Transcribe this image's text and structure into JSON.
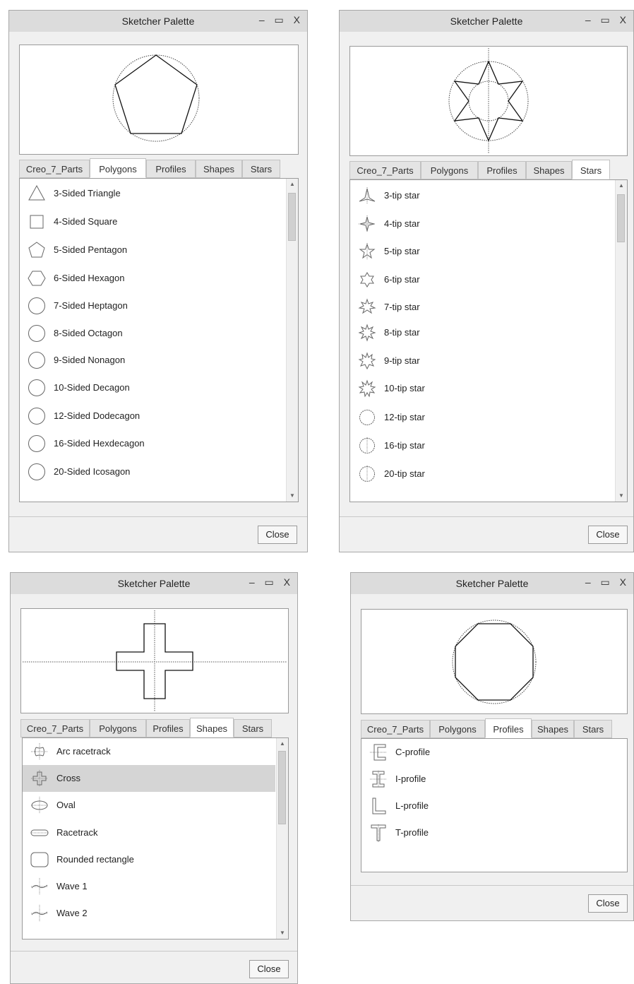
{
  "window_title": "Sketcher Palette",
  "tab_labels": [
    "Creo_7_Parts",
    "Polygons",
    "Profiles",
    "Shapes",
    "Stars"
  ],
  "close_label": "Close",
  "controls": {
    "minimize": "–",
    "maximize": "▭",
    "close": "X"
  },
  "windows": [
    {
      "active_tab": "Polygons",
      "items": [
        {
          "label": "3-Sided Triangle",
          "icon": "triangle-icon"
        },
        {
          "label": "4-Sided Square",
          "icon": "square-icon"
        },
        {
          "label": "5-Sided Pentagon",
          "icon": "pentagon-icon"
        },
        {
          "label": "6-Sided Hexagon",
          "icon": "hexagon-icon"
        },
        {
          "label": "7-Sided Heptagon",
          "icon": "heptagon-icon"
        },
        {
          "label": "8-Sided Octagon",
          "icon": "octagon-icon"
        },
        {
          "label": "9-Sided Nonagon",
          "icon": "nonagon-icon"
        },
        {
          "label": "10-Sided Decagon",
          "icon": "decagon-icon"
        },
        {
          "label": "12-Sided Dodecagon",
          "icon": "dodecagon-icon"
        },
        {
          "label": "16-Sided Hexdecagon",
          "icon": "hexdecagon-icon"
        },
        {
          "label": "20-Sided Icosagon",
          "icon": "icosagon-icon"
        }
      ]
    },
    {
      "active_tab": "Stars",
      "items": [
        {
          "label": "3-tip star",
          "icon": "star-3-icon"
        },
        {
          "label": "4-tip star",
          "icon": "star-4-icon"
        },
        {
          "label": "5-tip star",
          "icon": "star-5-icon"
        },
        {
          "label": "6-tip star",
          "icon": "star-6-icon"
        },
        {
          "label": "7-tip star",
          "icon": "star-7-icon"
        },
        {
          "label": "8-tip star",
          "icon": "star-8-icon"
        },
        {
          "label": "9-tip star",
          "icon": "star-9-icon"
        },
        {
          "label": "10-tip star",
          "icon": "star-10-icon"
        },
        {
          "label": "12-tip star",
          "icon": "star-12-icon"
        },
        {
          "label": "16-tip star",
          "icon": "star-16-icon"
        },
        {
          "label": "20-tip star",
          "icon": "star-20-icon"
        }
      ]
    },
    {
      "active_tab": "Shapes",
      "selected_item": "Cross",
      "items": [
        {
          "label": "Arc racetrack",
          "icon": "arc-racetrack-icon"
        },
        {
          "label": "Cross",
          "icon": "cross-icon"
        },
        {
          "label": "Oval",
          "icon": "oval-icon"
        },
        {
          "label": "Racetrack",
          "icon": "racetrack-icon"
        },
        {
          "label": "Rounded rectangle",
          "icon": "rounded-rectangle-icon"
        },
        {
          "label": "Wave 1",
          "icon": "wave-1-icon"
        },
        {
          "label": "Wave 2",
          "icon": "wave-2-icon"
        }
      ]
    },
    {
      "active_tab": "Profiles",
      "items": [
        {
          "label": "C-profile",
          "icon": "c-profile-icon"
        },
        {
          "label": "I-profile",
          "icon": "i-profile-icon"
        },
        {
          "label": "L-profile",
          "icon": "l-profile-icon"
        },
        {
          "label": "T-profile",
          "icon": "t-profile-icon"
        }
      ]
    }
  ]
}
